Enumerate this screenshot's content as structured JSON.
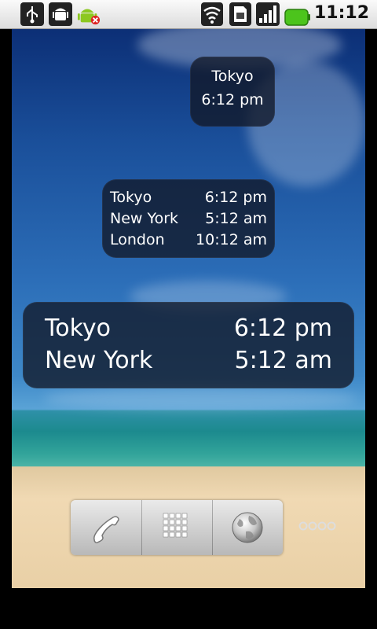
{
  "status_bar": {
    "time": "11:12",
    "icons": [
      "usb-icon",
      "android-debug-icon",
      "android-error-icon",
      "wifi-icon",
      "sim-card-icon",
      "signal-icon",
      "battery-icon"
    ],
    "battery_color": "#4cc41c"
  },
  "widgets": {
    "small": {
      "city": "Tokyo",
      "time": "6:12 pm"
    },
    "medium": [
      {
        "city": "Tokyo",
        "time": "6:12 pm"
      },
      {
        "city": "New York",
        "time": "5:12 am"
      },
      {
        "city": "London",
        "time": "10:12 am"
      }
    ],
    "large": [
      {
        "city": "Tokyo",
        "time": "6:12 pm"
      },
      {
        "city": "New York",
        "time": "5:12 am"
      }
    ]
  },
  "dock": {
    "buttons": [
      "phone-icon",
      "app-drawer-icon",
      "browser-globe-icon"
    ],
    "more": "more-icon"
  }
}
